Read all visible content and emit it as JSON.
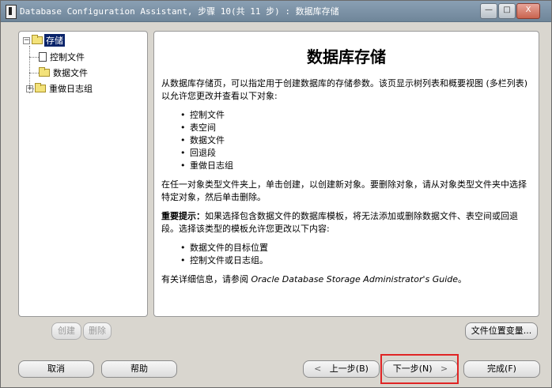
{
  "window": {
    "title": "Database Configuration Assistant, 步骤 10(共 11 步) : 数据库存储",
    "min_label": "—",
    "max_label": "□",
    "close_label": "X"
  },
  "tree": {
    "root": {
      "label": "存储",
      "expanded": true,
      "expander": "−"
    },
    "children": [
      {
        "label": "控制文件",
        "icon": "file-icon"
      },
      {
        "label": "数据文件",
        "icon": "folder-icon"
      },
      {
        "label": "重做日志组",
        "icon": "folder-icon",
        "expander": "+"
      }
    ]
  },
  "content": {
    "title": "数据库存储",
    "intro": "从数据库存储页，可以指定用于创建数据库的存储参数。该页显示树列表和概要视图 (多栏列表) 以允许您更改并查看以下对象:",
    "objects": [
      "控制文件",
      "表空间",
      "数据文件",
      "回退段",
      "重做日志组"
    ],
    "create_delete": "在任一对象类型文件夹上，单击创建，以创建新对象。要删除对象，请从对象类型文件夹中选择特定对象，然后单击删除。",
    "important_label": "重要提示：",
    "important": "如果选择包含数据文件的数据库模板，将无法添加或删除数据文件、表空间或回退段。选择该类型的模板允许您更改以下内容:",
    "changes": [
      "数据文件的目标位置",
      "控制文件或日志组。"
    ],
    "more_info_prefix": "有关详细信息，请参阅 ",
    "more_info_guide": "Oracle Database Storage Administrator's Guide",
    "more_info_suffix": "。"
  },
  "buttons": {
    "create": "创建",
    "delete": "删除",
    "file_location": "文件位置变量...",
    "cancel": "取消",
    "help": "帮助",
    "back": "上一步(B)",
    "back_arrow": "<",
    "next": "下一步(N)",
    "next_arrow": ">",
    "finish": "完成(F)"
  },
  "colors": {
    "selection": "#0a246a",
    "highlight": "#e02424"
  }
}
